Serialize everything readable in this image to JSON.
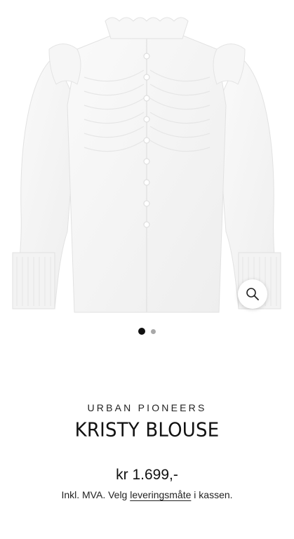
{
  "product": {
    "brand": "URBAN PIONEERS",
    "name": "KRISTY BLOUSE",
    "price": "kr 1.699,-",
    "vat_prefix": "Inkl. MVA. Velg ",
    "vat_link": "leveringsmåte",
    "vat_suffix": " i kassen."
  },
  "gallery": {
    "image_icon": "white-blouse-photo",
    "zoom_icon": "magnifier-icon",
    "slide_count": 2,
    "active_slide": 1
  },
  "colors": {
    "dot_active": "#111111",
    "dot_inactive": "#a8a8a8",
    "background": "#ffffff"
  }
}
